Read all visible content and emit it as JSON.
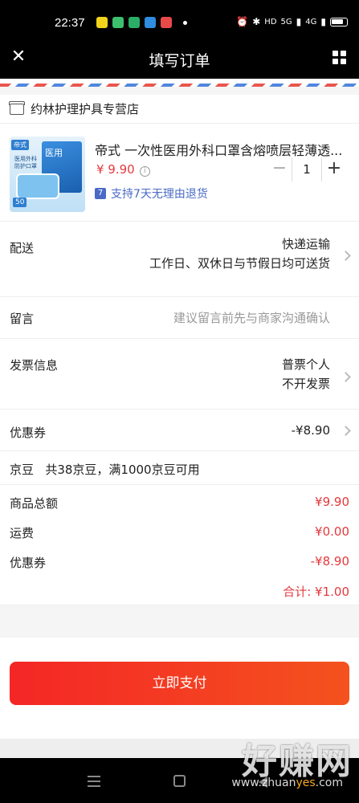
{
  "status_bar": {
    "time": "22:37",
    "network_label": "4G",
    "signal_label": "5G",
    "hd_label": "HD",
    "app_colors": [
      "#f2d21b",
      "#3dbf6e",
      "#2aae67",
      "#2f8ce0",
      "#e84a4a"
    ]
  },
  "header": {
    "title": "填写订单",
    "close_icon": "close-icon",
    "menu_icon": "grid-menu-icon"
  },
  "store": {
    "name": "约林护理护具专营店"
  },
  "product": {
    "name": "帝式 一次性医用外科口罩含熔喷层轻薄透...",
    "price": "¥ 9.90",
    "return_policy_badge": "7",
    "return_policy": "支持7天无理由退货",
    "quantity": "1",
    "image_texts": {
      "tag": "帝式",
      "box": "医用",
      "desc": "医用外科 防护口罩",
      "count": "50"
    }
  },
  "shipping": {
    "label": "配送",
    "method": "快递运输",
    "note": "工作日、双休日与节假日均可送货"
  },
  "message": {
    "label": "留言",
    "placeholder": "建议留言前先与商家沟通确认"
  },
  "invoice": {
    "label": "发票信息",
    "type": "普票个人",
    "status": "不开发票"
  },
  "coupon": {
    "label": "优惠券",
    "value": "-¥8.90"
  },
  "jingdou": {
    "label": "京豆",
    "text": "共38京豆，满1000京豆可用"
  },
  "summary": {
    "goods_total_label": "商品总额",
    "goods_total": "¥9.90",
    "shipping_fee_label": "运费",
    "shipping_fee": "¥0.00",
    "coupon_label": "优惠券",
    "coupon_value": "-¥8.90",
    "total": "合计: ¥1.00"
  },
  "pay_button": {
    "label": "立即支付"
  },
  "watermark": {
    "main": "好赚网",
    "sub_prefix": "www.zhuan",
    "sub_highlight": "yes",
    "sub_suffix": ".com"
  },
  "colors": {
    "accent_red": "#e4393c",
    "pay_gradient_start": "#f42626",
    "pay_gradient_end": "#f4521e",
    "link_blue": "#4a6ac6"
  }
}
